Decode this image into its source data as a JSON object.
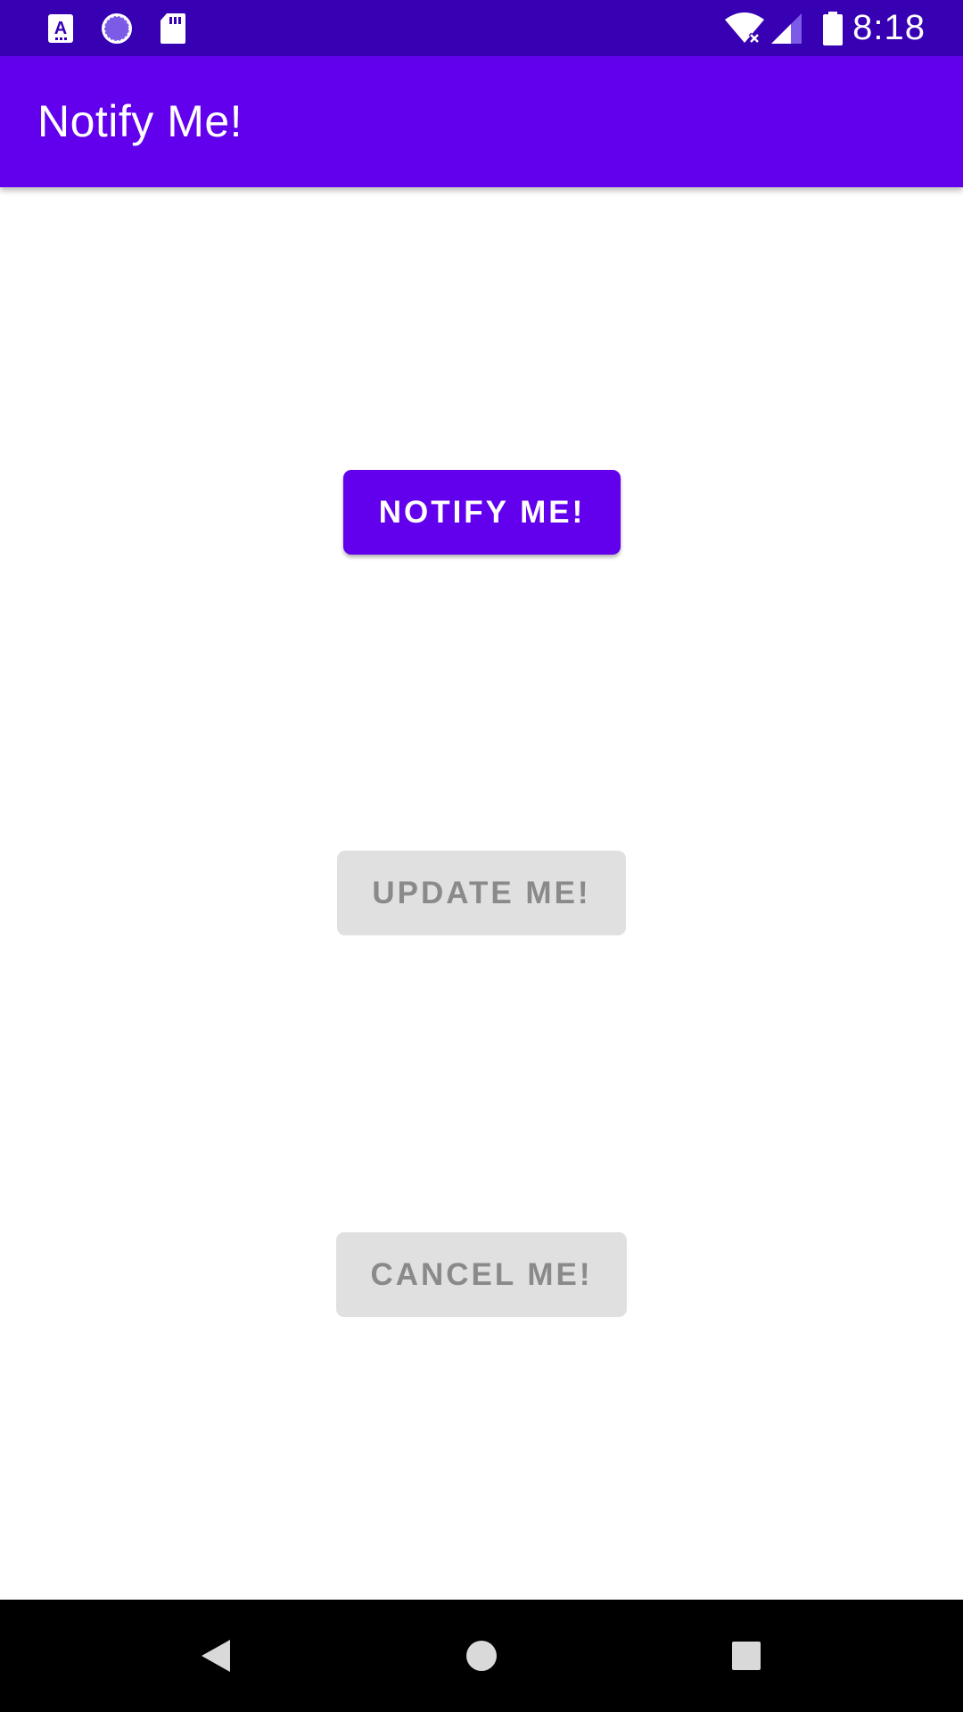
{
  "status_bar": {
    "time": "8:18",
    "left_icons": [
      "app-a-icon",
      "loading-circle-icon",
      "sd-card-icon"
    ],
    "right_icons": [
      "wifi-off-icon",
      "cell-signal-icon",
      "battery-icon"
    ],
    "color": "#3700b3"
  },
  "app_bar": {
    "title": "Notify Me!",
    "color": "#6200ee"
  },
  "main": {
    "notify_button_label": "NOTIFY ME!",
    "update_button_label": "UPDATE ME!",
    "cancel_button_label": "CANCEL ME!"
  },
  "colors": {
    "accent": "#6200ee",
    "disabled_background": "#e0e0e0",
    "disabled_text": "#8a8a8a"
  },
  "nav_bar": {
    "icons": [
      "back-icon",
      "home-icon",
      "recents-icon"
    ]
  }
}
